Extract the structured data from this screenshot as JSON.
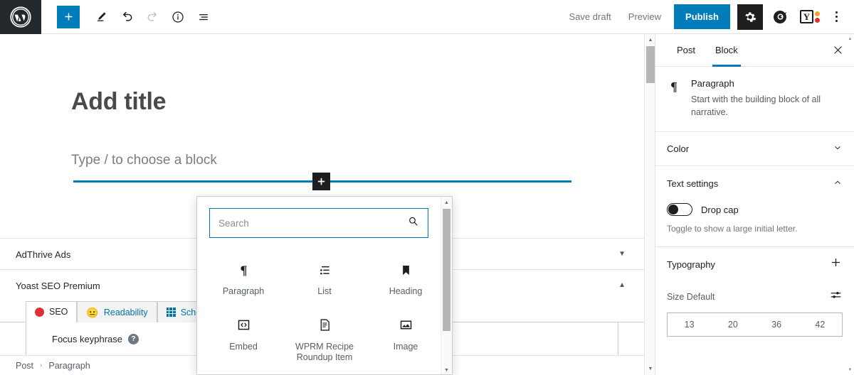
{
  "toolbar": {
    "logo_icon": "wordpress-logo",
    "add_block_label": "+",
    "add_block_icon": "plus-icon",
    "edit_icon": "pencil-icon",
    "undo_icon": "undo-arrow-icon",
    "redo_icon": "redo-arrow-icon",
    "info_icon": "info-circle-icon",
    "list_view_icon": "list-view-icon",
    "save_draft_label": "Save draft",
    "preview_label": "Preview",
    "publish_label": "Publish",
    "settings_icon": "gear-icon",
    "grammarly_icon": "grammarly-icon",
    "yoast_icon": "yoast-seo-icon",
    "yoast_letter": "Y",
    "more_icon": "kebab-menu-icon",
    "publish_color": "#007cba",
    "logo_bg": "#23282d"
  },
  "editor": {
    "title_placeholder": "Add title",
    "block_placeholder": "Type / to choose a block",
    "inserter_line_color": "#007cba",
    "inline_inserter_icon": "plus-icon",
    "meta_panels": [
      {
        "title": "AdThrive Ads",
        "toggle_icon": "chevron-down-icon",
        "state": "collapsed"
      },
      {
        "title": "Yoast SEO Premium",
        "toggle_icon": "chevron-up-icon",
        "state": "expanded"
      }
    ],
    "yoast": {
      "tabs": [
        {
          "label": "SEO",
          "icon": "red-dot-icon",
          "active": true,
          "color": "#dc3232"
        },
        {
          "label": "Readability",
          "icon": "neutral-face-icon",
          "active": false,
          "color": "#ee9322"
        },
        {
          "label": "Schema",
          "icon": "grid-icon",
          "active": false,
          "color": "#0073aa"
        }
      ],
      "focus_keyphrase_label": "Focus keyphrase",
      "help_icon": "question-mark-icon",
      "help_glyph": "?"
    },
    "breadcrumb": {
      "items": [
        "Post",
        "Paragraph"
      ],
      "separator": "›"
    },
    "scrollbar": {
      "up_icon": "triangle-up-icon",
      "down_icon": "triangle-down-icon",
      "up_glyph": "▲",
      "down_glyph": "▼"
    }
  },
  "inserter": {
    "search_placeholder": "Search",
    "search_value": "",
    "search_icon": "magnifier-icon",
    "blocks": [
      {
        "label": "Paragraph",
        "icon": "paragraph-pilcrow-icon"
      },
      {
        "label": "List",
        "icon": "bulleted-list-icon"
      },
      {
        "label": "Heading",
        "icon": "heading-bookmark-icon"
      },
      {
        "label": "Embed",
        "icon": "code-embed-icon"
      },
      {
        "label": "WPRM Recipe Roundup Item",
        "icon": "recipe-document-icon"
      },
      {
        "label": "Image",
        "icon": "image-icon"
      }
    ],
    "scrollbar": {
      "up_glyph": "▲",
      "down_glyph": "▼"
    },
    "focus_border_color": "#007cba"
  },
  "sidebar": {
    "tabs": [
      {
        "label": "Post",
        "active": false
      },
      {
        "label": "Block",
        "active": true
      }
    ],
    "active_tab_color": "#007cba",
    "close_icon": "close-x-icon",
    "block_info": {
      "icon": "paragraph-pilcrow-icon",
      "title": "Paragraph",
      "description": "Start with the building block of all narrative."
    },
    "panels": [
      {
        "title": "Color",
        "toggle_icon": "chevron-down-icon",
        "state": "collapsed"
      },
      {
        "title": "Text settings",
        "toggle_icon": "chevron-up-icon",
        "state": "expanded"
      },
      {
        "title": "Typography",
        "toggle_icon": "plus-icon",
        "state": "collapsed"
      }
    ],
    "text_settings": {
      "drop_cap_label": "Drop cap",
      "drop_cap_enabled": false,
      "drop_cap_help": "Toggle to show a large initial letter."
    },
    "typography": {
      "size_label": "Size Default",
      "size_controls_icon": "sliders-icon",
      "presets": [
        "13",
        "20",
        "36",
        "42"
      ]
    },
    "scrollbar": {
      "up_glyph": "▲",
      "down_glyph": "▼"
    }
  }
}
